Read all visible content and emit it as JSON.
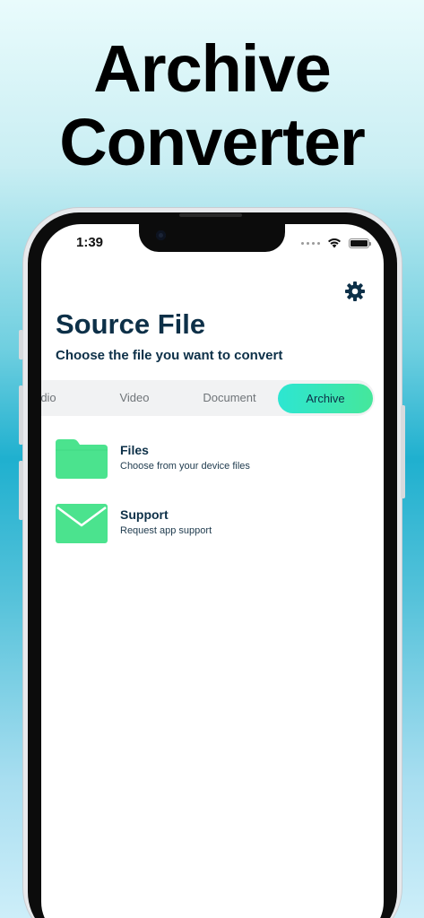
{
  "headline": {
    "line1": "Archive",
    "line2": "Converter"
  },
  "status_bar": {
    "time": "1:39"
  },
  "header": {
    "title": "Source File",
    "subtitle": "Choose the file you want to convert"
  },
  "tabs": [
    {
      "label": "dio",
      "active": false
    },
    {
      "label": "Video",
      "active": false
    },
    {
      "label": "Document",
      "active": false
    },
    {
      "label": "Archive",
      "active": true
    }
  ],
  "options": [
    {
      "title": "Files",
      "subtitle": "Choose from your device files",
      "icon": "folder-icon"
    },
    {
      "title": "Support",
      "subtitle": "Request app support",
      "icon": "envelope-icon"
    }
  ],
  "colors": {
    "accent_green": "#45e79b",
    "accent_teal": "#2de6d2",
    "icon_green": "#4be38e",
    "text_dark": "#0d3048"
  },
  "icons": {
    "settings": "gear-icon",
    "wifi": "wifi-icon",
    "battery": "battery-icon"
  }
}
